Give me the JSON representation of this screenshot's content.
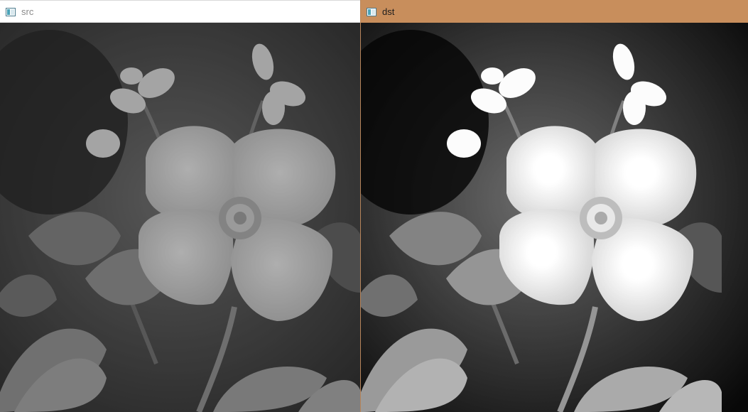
{
  "windows": [
    {
      "title": "src",
      "icon": "image-window-icon",
      "active": false
    },
    {
      "title": "dst",
      "icon": "image-window-icon",
      "active": true
    }
  ],
  "colors": {
    "active_titlebar": "#c88e5c",
    "inactive_titlebar": "#ffffff",
    "window_border": "#b7845a"
  }
}
